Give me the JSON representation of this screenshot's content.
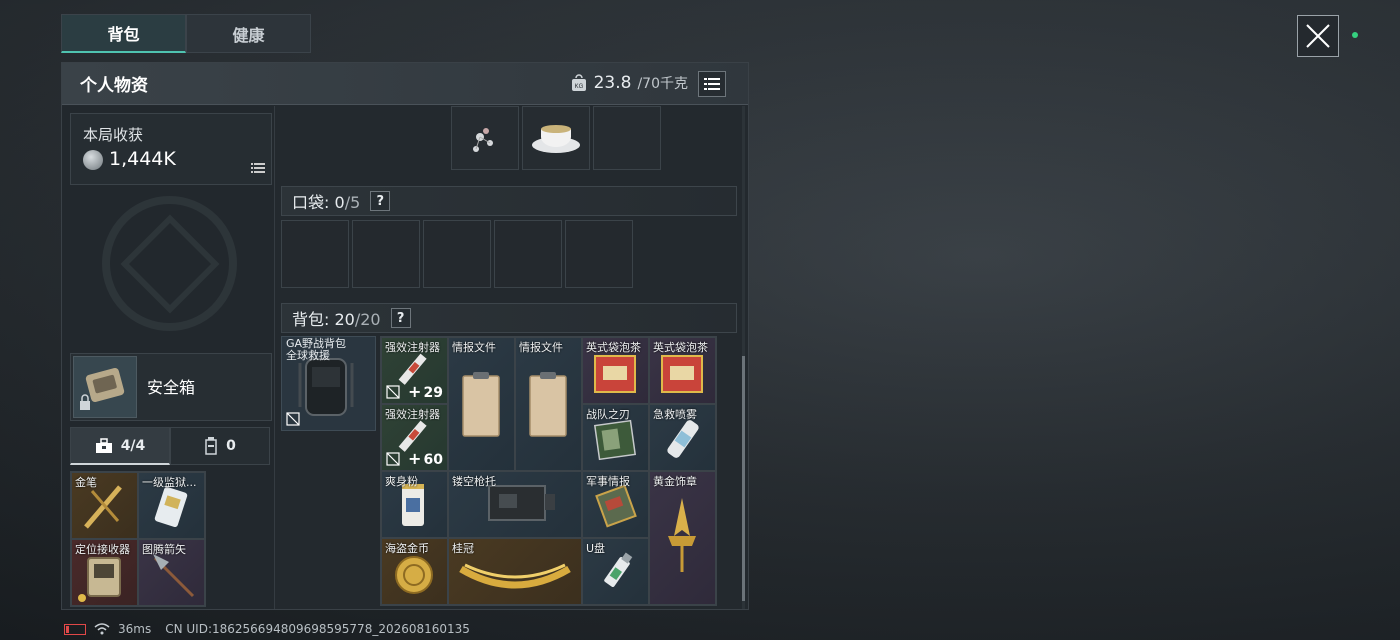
{
  "tabs": [
    {
      "label": "背包",
      "active": true
    },
    {
      "label": "健康",
      "active": false
    }
  ],
  "panel": {
    "title": "个人物资",
    "weight_current": "23.8",
    "weight_cap": "/70千克"
  },
  "earnings": {
    "label": "本局收获",
    "value": "1,444K"
  },
  "safe_box": {
    "label": "安全箱"
  },
  "mini_tabs": [
    {
      "label": "4/4",
      "icon": "toolbox-icon",
      "active": true
    },
    {
      "label": "0",
      "icon": "canister-icon",
      "active": false
    }
  ],
  "safe_items": [
    {
      "label": "金笔",
      "rarity": "gold"
    },
    {
      "label": "一级监狱...",
      "rarity": "blue"
    },
    {
      "label": "定位接收器",
      "rarity": "red"
    },
    {
      "label": "图腾箭矢",
      "rarity": "purple"
    }
  ],
  "top_items": [
    {
      "label": "",
      "rarity": "grey"
    },
    {
      "label": "",
      "rarity": "grey"
    },
    {
      "label": "",
      "rarity": "grey"
    }
  ],
  "pocket": {
    "label": "口袋:",
    "used": "0",
    "cap": "/5",
    "help": "?"
  },
  "backpack": {
    "label": "背包:",
    "used": "20",
    "cap": "/20",
    "help": "?"
  },
  "backpack_equip": {
    "label": "GA野战背包\n全球救援"
  },
  "backpack_items": {
    "syringe1": {
      "label": "强效注射器",
      "count": "29"
    },
    "syringe2": {
      "label": "强效注射器",
      "count": "60"
    },
    "doc1": {
      "label": "情报文件"
    },
    "doc2": {
      "label": "情报文件"
    },
    "tea1": {
      "label": "英式袋泡茶"
    },
    "tea2": {
      "label": "英式袋泡茶"
    },
    "blade": {
      "label": "战队之刃"
    },
    "spray": {
      "label": "急救喷雾"
    },
    "powder": {
      "label": "爽身粉"
    },
    "stock": {
      "label": "镂空枪托"
    },
    "intel": {
      "label": "军事情报"
    },
    "badge": {
      "label": "黄金饰章"
    },
    "coin": {
      "label": "海盗金币"
    },
    "crown": {
      "label": "桂冠"
    },
    "usb": {
      "label": "U盘"
    }
  },
  "footer": {
    "ping": "36ms",
    "uid": "CN UID:1862566948096985957​78_202608160135"
  },
  "colors": {
    "accent": "#4fc3b0",
    "gold": "#4a3a22",
    "purple": "#3a3446",
    "blue": "#2c3a45",
    "green": "#2f4235",
    "red": "#4a2a2a"
  }
}
